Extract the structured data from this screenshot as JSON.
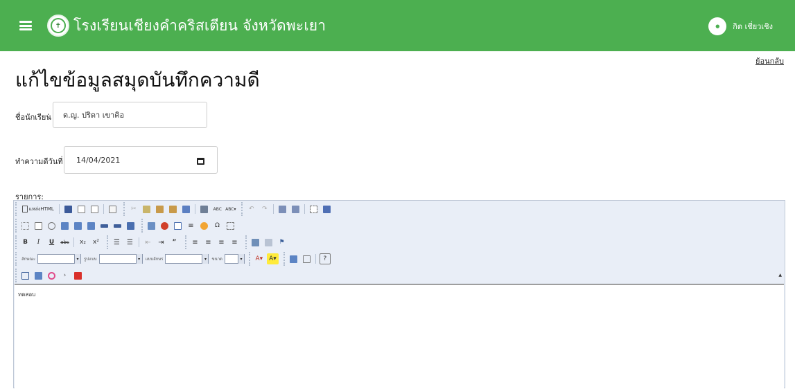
{
  "header": {
    "title": "โรงเรียนเชียงคำคริสเตียน จังหวัดพะเยา",
    "user_name": "กิต เชี่ยวเชิง",
    "menu_icon": "hamburger-icon",
    "logo": "school-logo",
    "bg_color": "#4caf50"
  },
  "page": {
    "back_link": "ย้อนกลับ",
    "title": "แก้ไขข้อมูลสมุดบันทึกความดี"
  },
  "form": {
    "student_label": "ชื่อนักเรียน",
    "student_value": "ด.ญ. ปริดา เขาคิอ",
    "date_label": "ทำความดีวันที่",
    "date_value": "14/04/2021",
    "details_label": "รายการ"
  },
  "editor": {
    "source_label": "แหล่งHTML",
    "style_label": "ลักษณะ",
    "format_label": "รูปแบบ",
    "font_label": "แบบอักษร",
    "size_label": "ขนาด",
    "content": "ทดสอบ"
  }
}
